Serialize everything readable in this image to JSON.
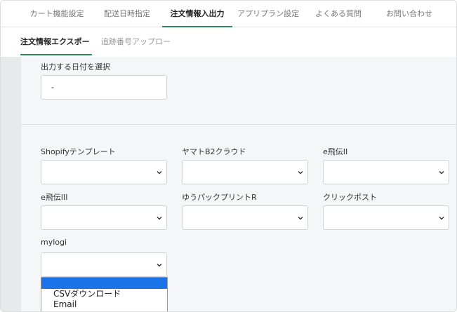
{
  "top_tabs": [
    {
      "label": "カート機能設定"
    },
    {
      "label": "配送日時指定"
    },
    {
      "label": "注文情報入出力"
    },
    {
      "label": "アプリプラン設定"
    },
    {
      "label": "よくある質問"
    },
    {
      "label": "お問い合わせ"
    }
  ],
  "sub_tabs": [
    {
      "label": "注文情報エクスポート"
    },
    {
      "label": "追跡番号アップロード"
    }
  ],
  "date_select": {
    "label": "出力する日付を選択",
    "value": "-"
  },
  "templates": [
    {
      "label": "Shopifyテンプレート"
    },
    {
      "label": "ヤマトB2クラウド"
    },
    {
      "label": "e飛伝II"
    },
    {
      "label": "e飛伝III"
    },
    {
      "label": "ゆうパックプリントR"
    },
    {
      "label": "クリックポスト"
    },
    {
      "label": "mylogi"
    }
  ],
  "dropdown": {
    "options": [
      {
        "label": ""
      },
      {
        "label": "CSVダウンロード"
      },
      {
        "label": "Email"
      }
    ],
    "highlight_color": "#1a73e8"
  },
  "colors": {
    "accent": "#2e8b57"
  }
}
